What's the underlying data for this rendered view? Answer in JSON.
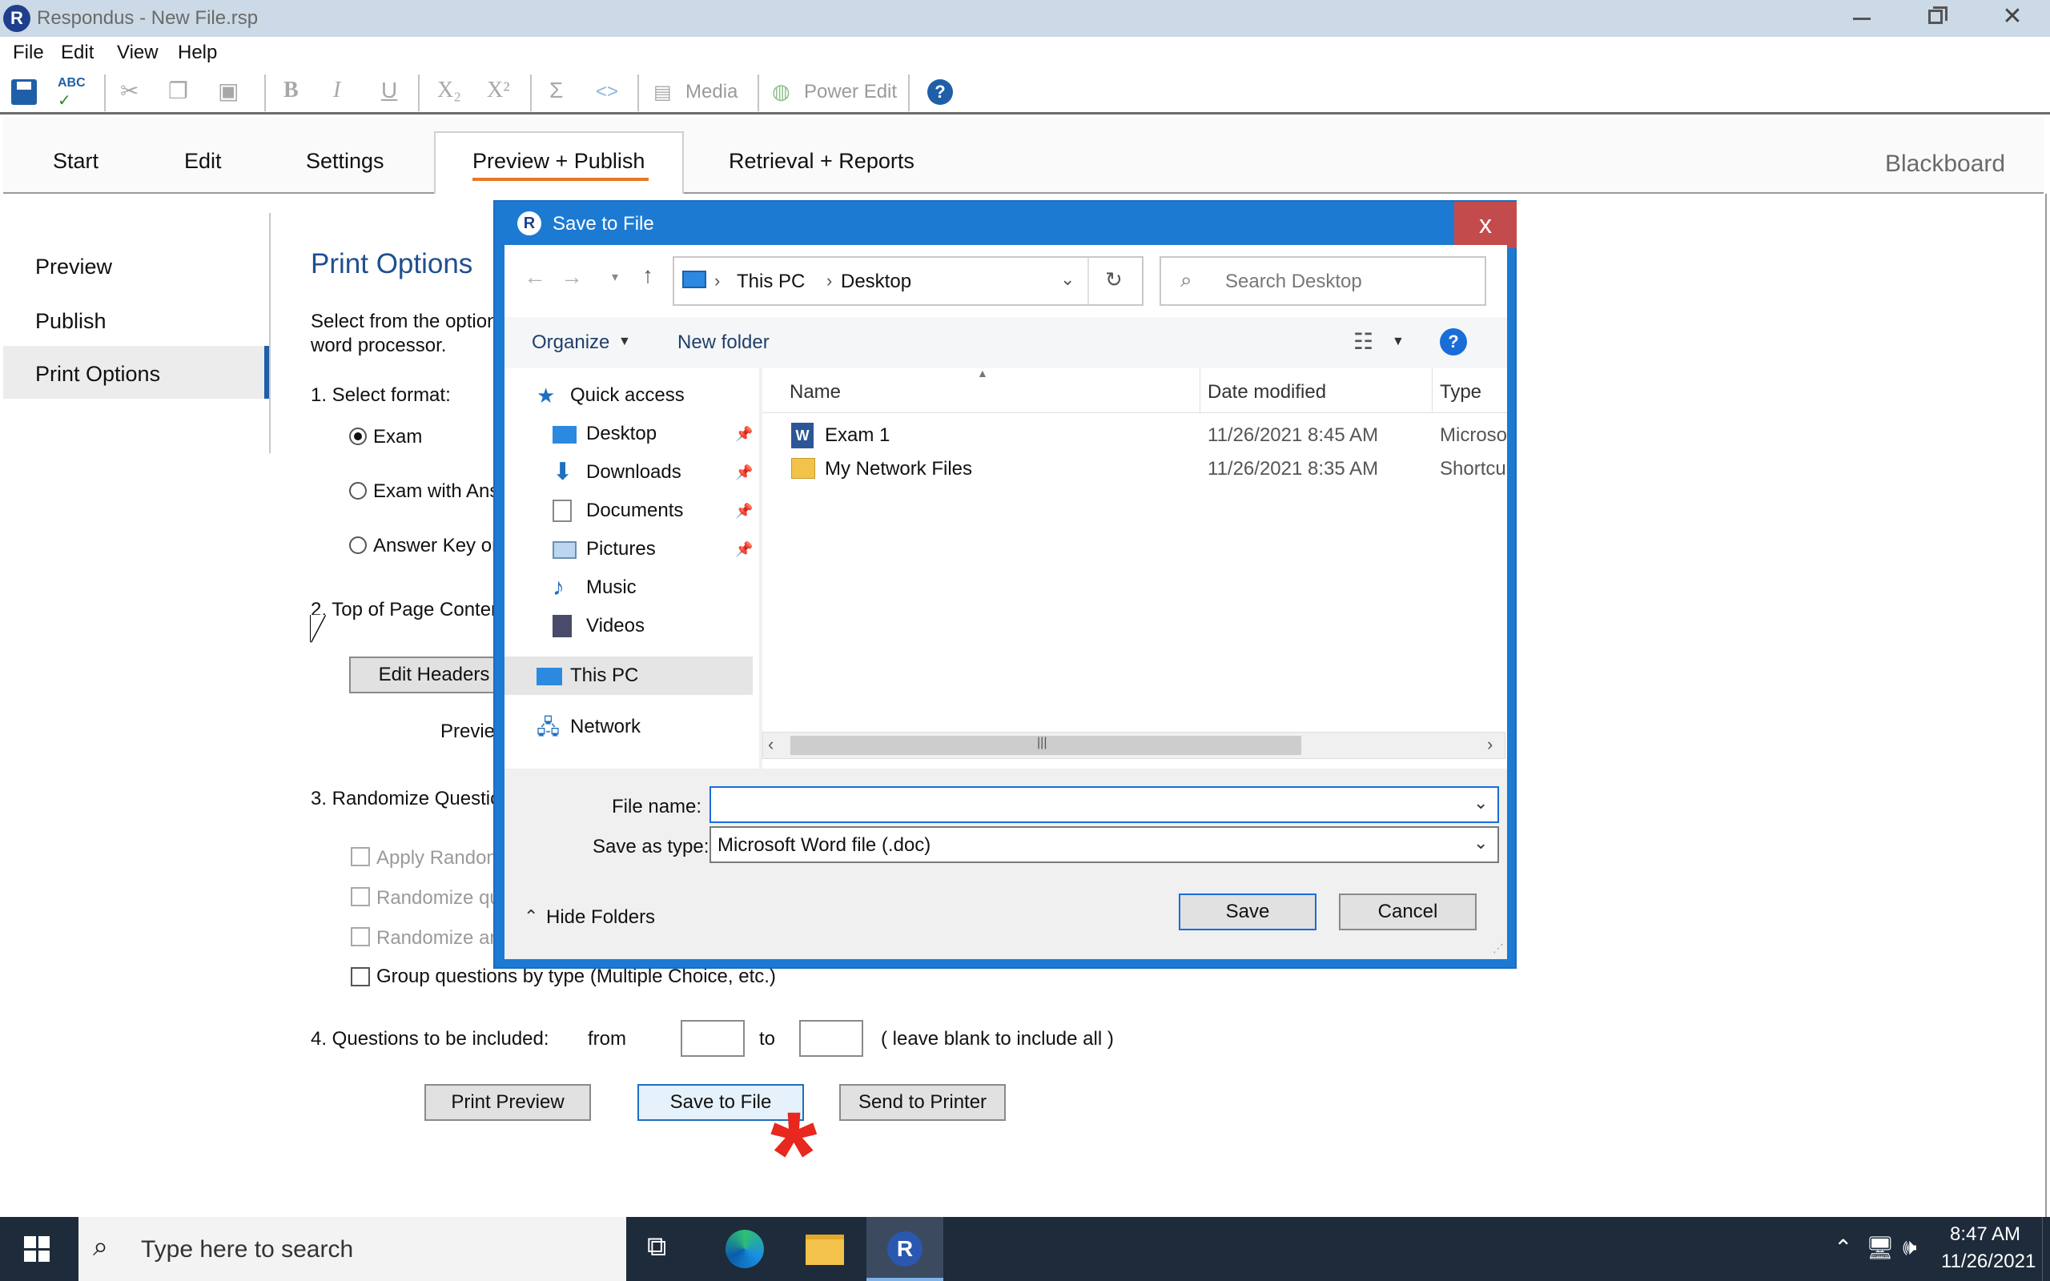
{
  "window": {
    "app_icon_letter": "R",
    "title": "Respondus - New File.rsp"
  },
  "menu": [
    "File",
    "Edit",
    "View",
    "Help"
  ],
  "toolbar": {
    "media_label": "Media",
    "power_edit_label": "Power Edit"
  },
  "tabs": [
    "Start",
    "Edit",
    "Settings",
    "Preview + Publish",
    "Retrieval + Reports"
  ],
  "active_tab": "Preview + Publish",
  "lms_label": "Blackboard",
  "sidebar": {
    "items": [
      "Preview",
      "Publish",
      "Print Options"
    ],
    "active": "Print Options"
  },
  "main": {
    "title": "Print Options",
    "intro_line1": "Select from the option",
    "intro_line2": "word processor.",
    "section1": "1.  Select format:",
    "format_options": [
      "Exam",
      "Exam with Ans",
      "Answer Key or"
    ],
    "section2": "2.  Top of Page Conter",
    "edit_headers_label": "Edit Headers",
    "preview_label": "Previe",
    "section3": "3.  Randomize Questic",
    "randomize_options": [
      "Apply Randon",
      "Randomize qu",
      "Randomize ar"
    ],
    "group_label": "Group questions by type (Multiple Choice, etc.)",
    "section4": "4.  Questions to be included:",
    "from_label": "from",
    "to_label": "to",
    "from_value": "",
    "to_value": "",
    "blank_hint": "( leave blank to include all )",
    "print_preview_label": "Print Preview",
    "save_to_file_label": "Save to File",
    "send_to_printer_label": "Send to Printer"
  },
  "dialog": {
    "icon_letter": "R",
    "title": "Save to File",
    "close_glyph": "x",
    "breadcrumb": [
      "This PC",
      "Desktop"
    ],
    "search_placeholder": "Search Desktop",
    "organize_label": "Organize",
    "new_folder_label": "New folder",
    "help_glyph": "?",
    "nav": {
      "quick_access": "Quick access",
      "items": [
        "Desktop",
        "Downloads",
        "Documents",
        "Pictures",
        "Music",
        "Videos"
      ],
      "this_pc": "This PC",
      "network": "Network"
    },
    "columns": [
      "Name",
      "Date modified",
      "Type"
    ],
    "files": [
      {
        "name": "Exam 1",
        "date": "11/26/2021 8:45 AM",
        "type": "Microso"
      },
      {
        "name": "My Network Files",
        "date": "11/26/2021 8:35 AM",
        "type": "Shortcu"
      }
    ],
    "file_name_label": "File name:",
    "file_name_value": "",
    "save_as_type_label": "Save as type:",
    "save_as_type_value": "Microsoft Word file (.doc)",
    "hide_folders_label": "Hide Folders",
    "save_label": "Save",
    "cancel_label": "Cancel"
  },
  "taskbar": {
    "search_placeholder": "Type here to search",
    "time": "8:47 AM",
    "date": "11/26/2021",
    "taskbar_app_letter": "R"
  },
  "colors": {
    "accent_tab_underline": "#e87722",
    "dialog_blue": "#1c7ad3",
    "close_red": "#c44b4b",
    "asterisk_red": "#e8271f"
  }
}
